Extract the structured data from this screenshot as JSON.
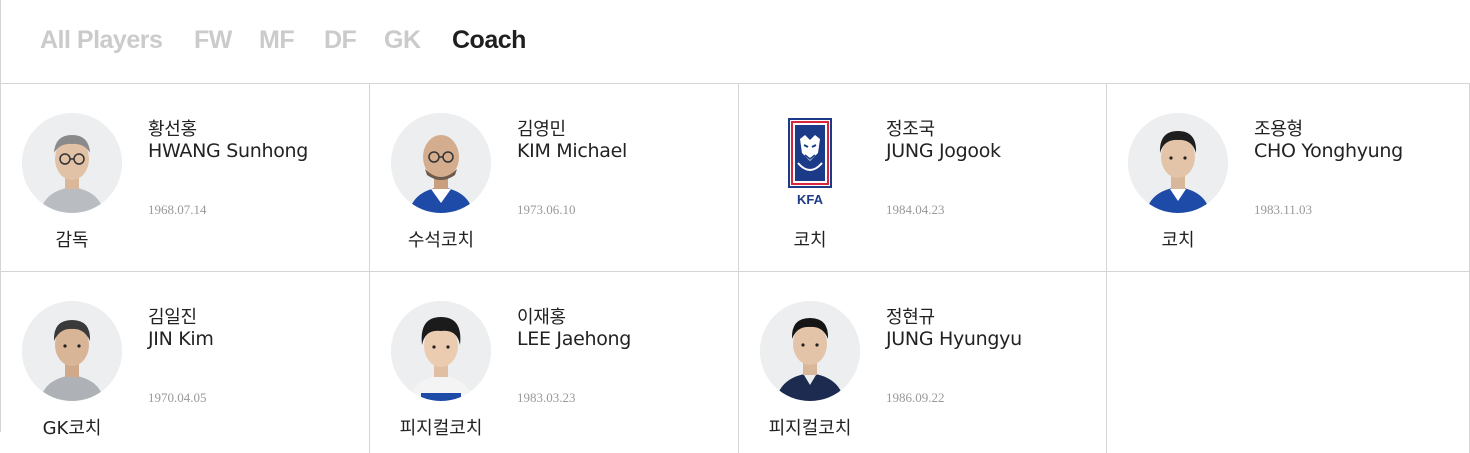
{
  "tabs": [
    {
      "label": "All Players"
    },
    {
      "label": "FW"
    },
    {
      "label": "MF"
    },
    {
      "label": "DF"
    },
    {
      "label": "GK"
    },
    {
      "label": "Coach"
    }
  ],
  "active_tab": "Coach",
  "colors": {
    "active_tab": "#1f1f1f",
    "inactive_tab": "#cbcbcb",
    "divider": "#d5d5d5",
    "birth_text": "#999999",
    "kfa_blue": "#1b3a87",
    "kfa_red": "#d7263d"
  },
  "coaches": [
    {
      "korean_name": "황선홍",
      "english_name": "HWANG Sunhong",
      "birth": "1968.07.14",
      "role": "감독",
      "photo": "portrait-glasses-grey"
    },
    {
      "korean_name": "김영민",
      "english_name": "KIM Michael",
      "birth": "1973.06.10",
      "role": "수석코치",
      "photo": "portrait-bald-glasses"
    },
    {
      "korean_name": "정조국",
      "english_name": "JUNG Jogook",
      "birth": "1984.04.23",
      "role": "코치",
      "photo": "kfa-logo",
      "logo_text": "KFA"
    },
    {
      "korean_name": "조용형",
      "english_name": "CHO Yonghyung",
      "birth": "1983.11.03",
      "role": "코치",
      "photo": "portrait-blue-jersey"
    },
    {
      "korean_name": "김일진",
      "english_name": "JIN Kim",
      "birth": "1970.04.05",
      "role": "GK코치",
      "photo": "portrait-grey-shirt"
    },
    {
      "korean_name": "이재홍",
      "english_name": "LEE Jaehong",
      "birth": "1983.03.23",
      "role": "피지컬코치",
      "photo": "portrait-white-shirt"
    },
    {
      "korean_name": "정현규",
      "english_name": "JUNG Hyungyu",
      "birth": "1986.09.22",
      "role": "피지컬코치",
      "photo": "portrait-navy-jacket"
    }
  ]
}
